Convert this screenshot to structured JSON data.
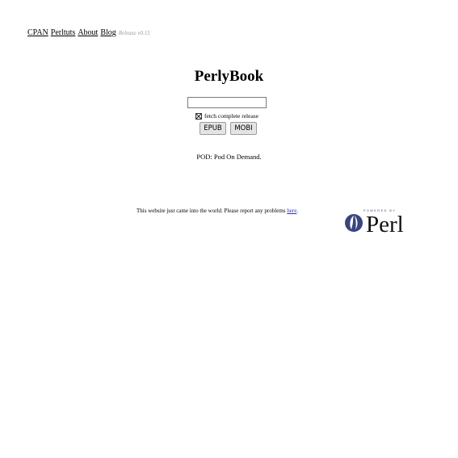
{
  "nav": {
    "links": [
      "CPAN",
      "Perltuts",
      "About",
      "Blog"
    ],
    "release": "Release v0.15"
  },
  "main": {
    "title": "PerlyBook",
    "search": {
      "value": "",
      "placeholder": ""
    },
    "fetch_checkbox": {
      "label": "fetch complete release",
      "checked": true
    },
    "buttons": {
      "epub": "EPUB",
      "mobi": "MOBI"
    },
    "tagline": "POD: Pod On Demand."
  },
  "footer": {
    "text": "This website just came into the world. Please report any problems ",
    "link_text": "here",
    "suffix": ".",
    "logo": {
      "powered_by": "POWERED BY",
      "name": "Perl",
      "icon": "perl-onion-icon"
    }
  },
  "colors": {
    "link": "#2b2bd6",
    "release_text": "#999999",
    "logo_blue": "#39457e"
  }
}
